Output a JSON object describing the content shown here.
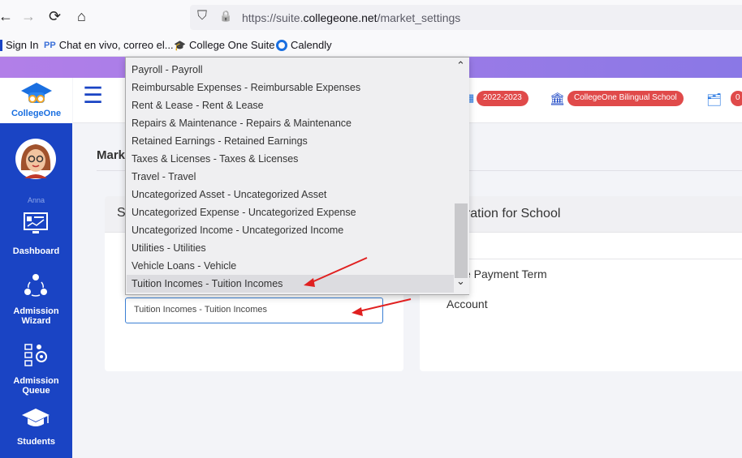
{
  "browser": {
    "url_prefix": "https://suite.",
    "url_domain": "collegeone.net",
    "url_path": "/market_settings",
    "back_glyph": "←",
    "forward_glyph": "→",
    "reload_glyph": "⟳",
    "home_glyph": "⌂",
    "shield_glyph": "⛉",
    "lock_glyph": "🔒",
    "bookmarks": [
      "Sign In",
      "Chat en vivo, correo el...",
      "College One Suite",
      "Calendly"
    ]
  },
  "header": {
    "logo_text": "CollegeOne",
    "menu_glyph": "☰",
    "year_pill": "2022-2023",
    "school_pill": "CollegeOne Bilingual School",
    "count_pill": "0"
  },
  "sidebar": {
    "user_name": "Anna",
    "items": [
      {
        "label_line1": "Dashboard",
        "label_line2": ""
      },
      {
        "label_line1": "Admission",
        "label_line2": "Wizard"
      },
      {
        "label_line1": "Admission",
        "label_line2": "Queue"
      },
      {
        "label_line1": "Students",
        "label_line2": ""
      }
    ]
  },
  "main": {
    "page_title_partial": "Mark",
    "card1_title_partial": "S",
    "card2_title_partial": "uration for School",
    "row1_partial": "ce Payment Term",
    "row2": "Account",
    "selected_field_value": "Tuition Incomes - Tuition Incomes"
  },
  "dropdown": {
    "options": [
      "Payroll - Payroll",
      "Reimbursable Expenses - Reimbursable Expenses",
      "Rent & Lease - Rent & Lease",
      "Repairs & Maintenance - Repairs & Maintenance",
      "Retained Earnings - Retained Earnings",
      "Taxes & Licenses - Taxes & Licenses",
      "Travel - Travel",
      "Uncategorized Asset - Uncategorized Asset",
      "Uncategorized Expense - Uncategorized Expense",
      "Uncategorized Income - Uncategorized Income",
      "Utilities - Utilities",
      "Vehicle Loans - Vehicle",
      "Tuition Incomes - Tuition Incomes"
    ],
    "selected_index": 12,
    "scroll_up_glyph": "⌃",
    "scroll_down_glyph": "⌄"
  },
  "colors": {
    "sidebar": "#1a44c4",
    "pill": "#e04a4a",
    "annotation_arrow": "#e02020"
  }
}
